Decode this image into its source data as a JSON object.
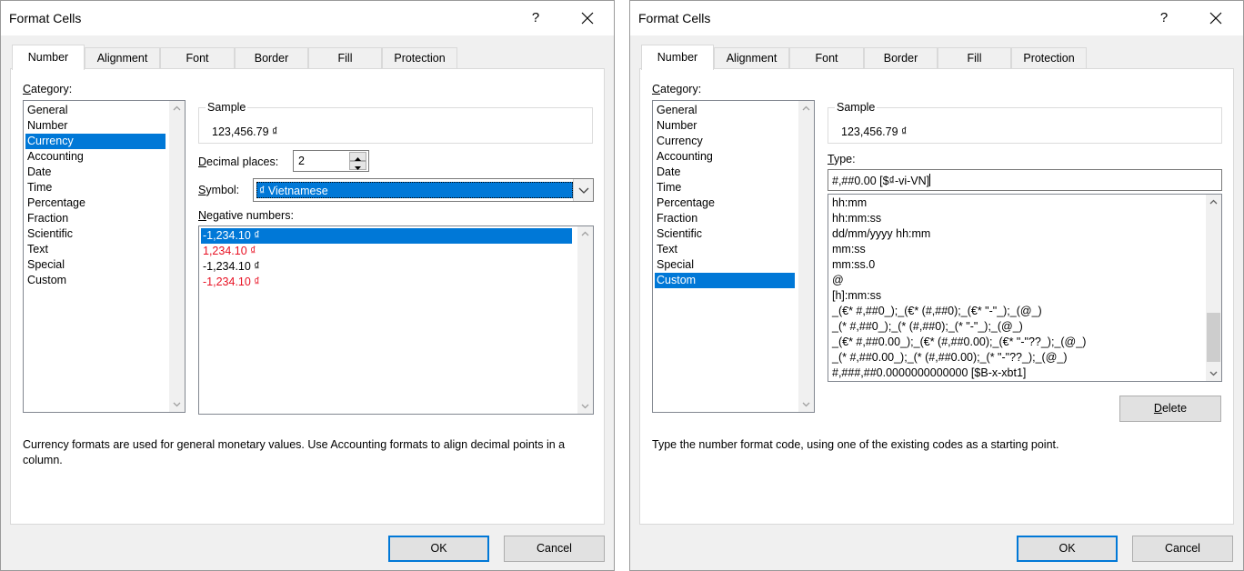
{
  "left": {
    "title": "Format Cells",
    "help": "?",
    "tabs": [
      "Number",
      "Alignment",
      "Font",
      "Border",
      "Fill",
      "Protection"
    ],
    "category_label": "Category:",
    "categories": [
      "General",
      "Number",
      "Currency",
      "Accounting",
      "Date",
      "Time",
      "Percentage",
      "Fraction",
      "Scientific",
      "Text",
      "Special",
      "Custom"
    ],
    "selected_category": "Currency",
    "sample_label": "Sample",
    "sample_value": "123,456.79 ₫",
    "decimal_label": "Decimal places:",
    "decimal_value": "2",
    "symbol_label": "Symbol:",
    "symbol_value": "₫ Vietnamese",
    "negative_label": "Negative numbers:",
    "negatives": [
      {
        "text": "-1,234.10 ₫",
        "color": "black",
        "selected": true
      },
      {
        "text": "1,234.10 ₫",
        "color": "red"
      },
      {
        "text": "-1,234.10 ₫",
        "color": "black"
      },
      {
        "text": "-1,234.10 ₫",
        "color": "red"
      }
    ],
    "description": "Currency formats are used for general monetary values.  Use Accounting formats to align decimal points in a column.",
    "ok": "OK",
    "cancel": "Cancel"
  },
  "right": {
    "title": "Format Cells",
    "help": "?",
    "tabs": [
      "Number",
      "Alignment",
      "Font",
      "Border",
      "Fill",
      "Protection"
    ],
    "category_label": "Category:",
    "categories": [
      "General",
      "Number",
      "Currency",
      "Accounting",
      "Date",
      "Time",
      "Percentage",
      "Fraction",
      "Scientific",
      "Text",
      "Special",
      "Custom"
    ],
    "selected_category": "Custom",
    "sample_label": "Sample",
    "sample_value": "123,456.79 ₫",
    "type_label": "Type:",
    "type_value": "#,##0.00 [$₫-vi-VN]",
    "type_list": [
      "hh:mm",
      "hh:mm:ss",
      "dd/mm/yyyy hh:mm",
      "mm:ss",
      "mm:ss.0",
      "@",
      "[h]:mm:ss",
      "_(€* #,##0_);_(€* (#,##0);_(€* \"-\"_);_(@_)",
      "_(* #,##0_);_(* (#,##0);_(* \"-\"_);_(@_)",
      "_(€* #,##0.00_);_(€* (#,##0.00);_(€* \"-\"??_);_(@_)",
      "_(* #,##0.00_);_(* (#,##0.00);_(* \"-\"??_);_(@_)",
      "#,###,##0.0000000000000 [$B-x-xbt1]"
    ],
    "delete": "Delete",
    "description": "Type the number format code, using one of the existing codes as a starting point.",
    "ok": "OK",
    "cancel": "Cancel"
  },
  "colors": {
    "accent": "#0078d7",
    "negative_red": "#e81123",
    "dialog_bg": "#f0f0f0"
  },
  "icons": [
    "close-icon",
    "chevron-down-icon",
    "chevron-up-icon",
    "spin-up-icon",
    "spin-down-icon"
  ]
}
